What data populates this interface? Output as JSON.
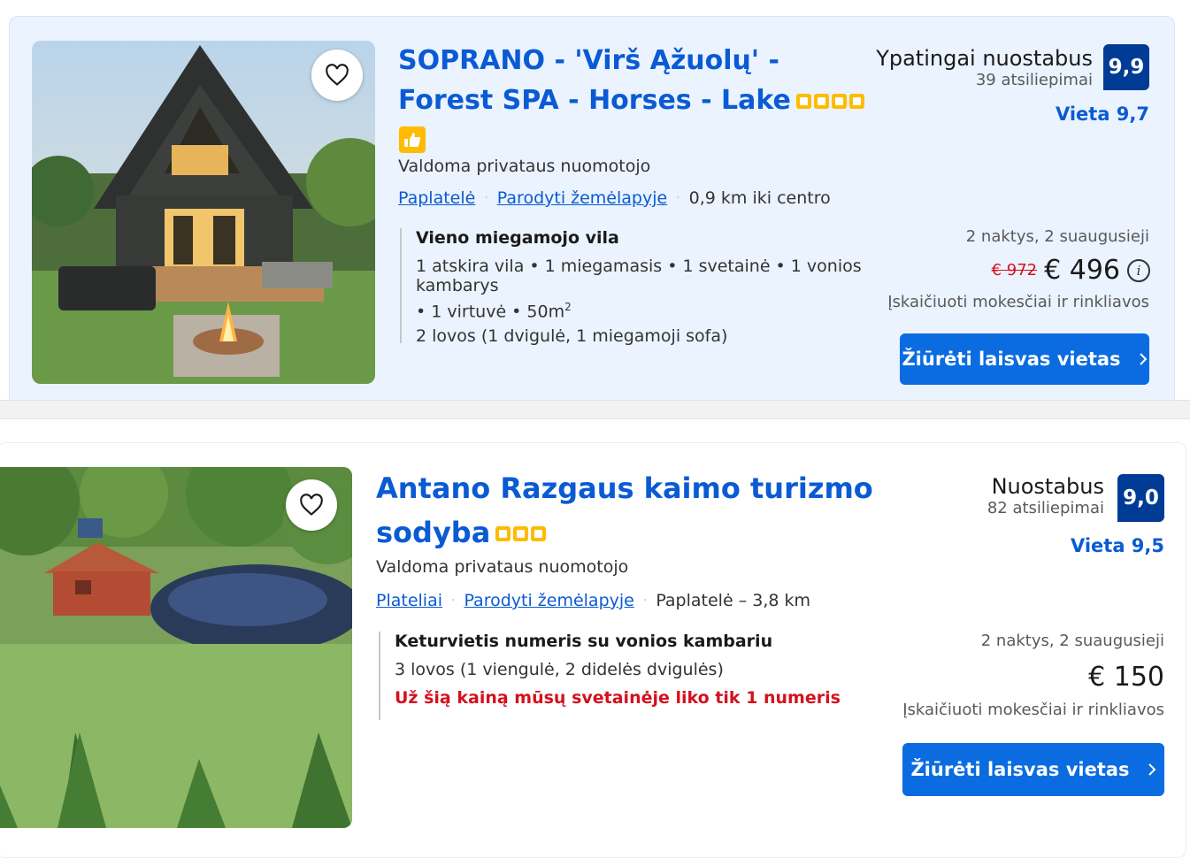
{
  "listings": [
    {
      "title_line1": "SOPRANO - 'Virš Ąžuolų' -",
      "title_line2": "Forest SPA - Horses - Lake",
      "stars": 4,
      "managed": "Valdoma privataus nuomotojo",
      "town_link": "Paplatelė",
      "map_link": "Parodyti žemėlapyje",
      "distance": "0,9 km iki centro",
      "room_name": "Vieno miegamojo vila",
      "room_line1": "1 atskira vila • 1 miegamasis • 1 svetainė • 1 vonios kambarys",
      "room_line2_text": "• 1 virtuvė • 50m",
      "room_line2_sup": "2",
      "room_line3": "2 lovos (1 dvigulė, 1 miegamoji sofa)",
      "review_word": "Ypatingai nuostabus",
      "review_count": "39 atsiliepimai",
      "score": "9,9",
      "location_score": "Vieta 9,7",
      "stay": "2 naktys, 2 suaugusieji",
      "old_price": "€ 972",
      "price": "€ 496",
      "taxes": "Įskaičiuoti mokesčiai ir rinkliavos",
      "cta": "Žiūrėti laisvas vietas"
    },
    {
      "title_line1": "Antano Razgaus kaimo turizmo",
      "title_line2": "sodyba",
      "stars": 3,
      "managed": "Valdoma privataus nuomotojo",
      "town_link": "Plateliai",
      "map_link": "Parodyti žemėlapyje",
      "distance": "Paplatelė – 3,8 km",
      "room_name": "Keturvietis numeris su vonios kambariu",
      "room_line1": "3 lovos (1 viengulė, 2 didelės dvigulės)",
      "warning": "Už šią kainą mūsų svetainėje liko tik 1 numeris",
      "review_word": "Nuostabus",
      "review_count": "82 atsiliepimai",
      "score": "9,0",
      "location_score": "Vieta 9,5",
      "stay": "2 naktys, 2 suaugusieji",
      "price": "€ 150",
      "taxes": "Įskaičiuoti mokesčiai ir rinkliavos",
      "cta": "Žiūrėti laisvas vietas"
    }
  ],
  "icons": [
    "heart-icon",
    "thumbs-up-icon",
    "info-icon",
    "chevron-right-icon",
    "star-icon"
  ],
  "colors": {
    "link": "#0a5bd3",
    "score_bg": "#003b95",
    "cta_bg": "#0a6ce0",
    "star": "#febb02",
    "alert": "#d4111e",
    "card_bg": "#ebf3ff"
  }
}
